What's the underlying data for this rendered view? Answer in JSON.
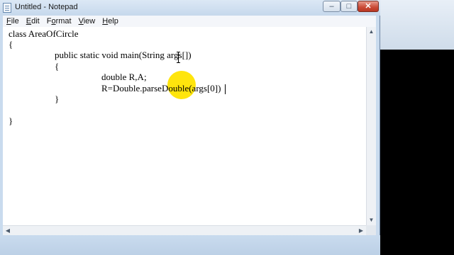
{
  "window": {
    "title": "Untitled - Notepad",
    "controls": {
      "minimize": "–",
      "maximize": "□",
      "close": "✕"
    }
  },
  "menu": {
    "items": [
      {
        "accel": "F",
        "rest": "ile"
      },
      {
        "accel": "E",
        "rest": "dit"
      },
      {
        "pre": "F",
        "accel": "o",
        "rest": "rmat"
      },
      {
        "accel": "V",
        "rest": "iew"
      },
      {
        "accel": "H",
        "rest": "elp"
      }
    ]
  },
  "editor": {
    "lines": [
      "class AreaOfCircle",
      "{",
      "public static void main(String args[])",
      "{",
      "double R,A;",
      "R=Double.parseDouble(args[0])",
      "}",
      "}"
    ]
  },
  "icons": {
    "app": "notepad-icon",
    "cursor": "ibeam-cursor-icon"
  },
  "colors": {
    "highlight": "#ffe400",
    "close_button": "#c94a36",
    "console_bg": "#000000"
  }
}
